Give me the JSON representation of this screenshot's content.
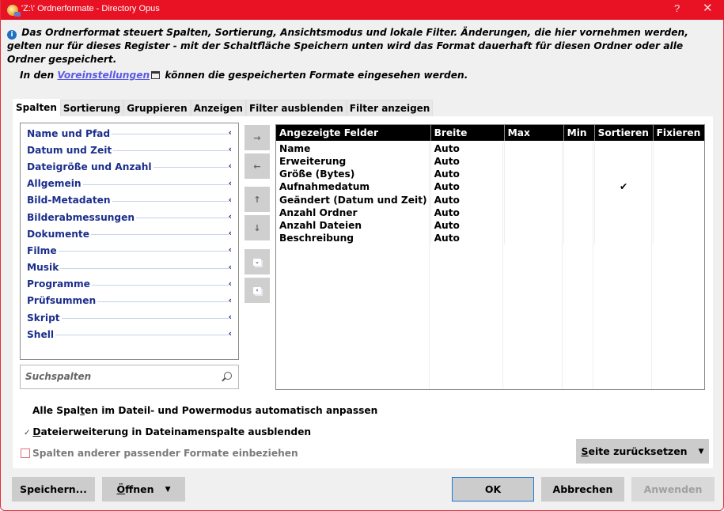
{
  "window": {
    "title": "'Z:\\' Ordnerformate - Directory Opus",
    "help_label": "?",
    "close_label": "✕"
  },
  "info": {
    "text": "Das Ordnerformat steuert Spalten, Sortierung, Ansichtsmodus und lokale Filter. Änderungen, die hier vornehmen werden, gelten nur für dieses Register - mit der Schaltfläche Speichern unten wird das Format dauerhaft für diesen Ordner oder alle Ordner gespeichert.",
    "line2_prefix": "In den",
    "line2_link": "Voreinstellungen",
    "line2_suffix": "können die gespeicherten Formate eingesehen werden."
  },
  "tabs": [
    {
      "label": "Spalten",
      "active": true
    },
    {
      "label": "Sortierung"
    },
    {
      "label": "Gruppieren"
    },
    {
      "label": "Anzeigen"
    },
    {
      "label": "Filter ausblenden"
    },
    {
      "label": "Filter anzeigen"
    }
  ],
  "field_groups": [
    "Name und Pfad",
    "Datum und Zeit",
    "Dateigröße und Anzahl",
    "Allgemein",
    "Bild-Metadaten",
    "Bilderabmessungen",
    "Dokumente",
    "Filme",
    "Musik",
    "Programme",
    "Prüfsummen",
    "Skript",
    "Shell"
  ],
  "search": {
    "placeholder": "Suchspalten"
  },
  "side_buttons": {
    "add": "→",
    "remove": "←",
    "up": "↑",
    "down": "↓",
    "expand": "⌄",
    "collapse": "‹"
  },
  "grid": {
    "headers": [
      "Angezeigte Felder",
      "Breite",
      "Max",
      "Min",
      "Sortieren",
      "Fixieren"
    ],
    "rows": [
      {
        "field": "Name",
        "width": "Auto",
        "max": "",
        "min": "",
        "sort": "",
        "fix": ""
      },
      {
        "field": "Erweiterung",
        "width": "Auto",
        "max": "",
        "min": "",
        "sort": "",
        "fix": ""
      },
      {
        "field": "Größe (Bytes)",
        "width": "Auto",
        "max": "",
        "min": "",
        "sort": "",
        "fix": ""
      },
      {
        "field": "Aufnahmedatum",
        "width": "Auto",
        "max": "",
        "min": "",
        "sort": "✔",
        "fix": ""
      },
      {
        "field": "Geändert (Datum und Zeit)",
        "width": "Auto",
        "max": "",
        "min": "",
        "sort": "",
        "fix": ""
      },
      {
        "field": "Anzahl Ordner",
        "width": "Auto",
        "max": "",
        "min": "",
        "sort": "",
        "fix": ""
      },
      {
        "field": "Anzahl Dateien",
        "width": "Auto",
        "max": "",
        "min": "",
        "sort": "",
        "fix": ""
      },
      {
        "field": "Beschreibung",
        "width": "Auto",
        "max": "",
        "min": "",
        "sort": "",
        "fix": ""
      }
    ]
  },
  "options": {
    "auto_fit": {
      "label_pre": "Alle Spal",
      "label_u": "t",
      "label_post": "en im Dateil- und Powermodus automatisch anpassen"
    },
    "hide_ext": {
      "tick": "✓",
      "label_u": "D",
      "label_post": "ateierweiterung in Dateinamenspalte ausblenden",
      "checked": true
    },
    "include_other": {
      "label": "Spalten anderer passender Formate einbeziehen",
      "checked": false,
      "enabled": false
    }
  },
  "buttons": {
    "reset_u": "S",
    "reset_rest": "eite zurücksetzen",
    "save": "Speichern...",
    "open_u": "Ö",
    "open_rest": "ffnen",
    "caret": "▼",
    "ok": "OK",
    "cancel": "Abbrechen",
    "apply": "Anwenden"
  }
}
